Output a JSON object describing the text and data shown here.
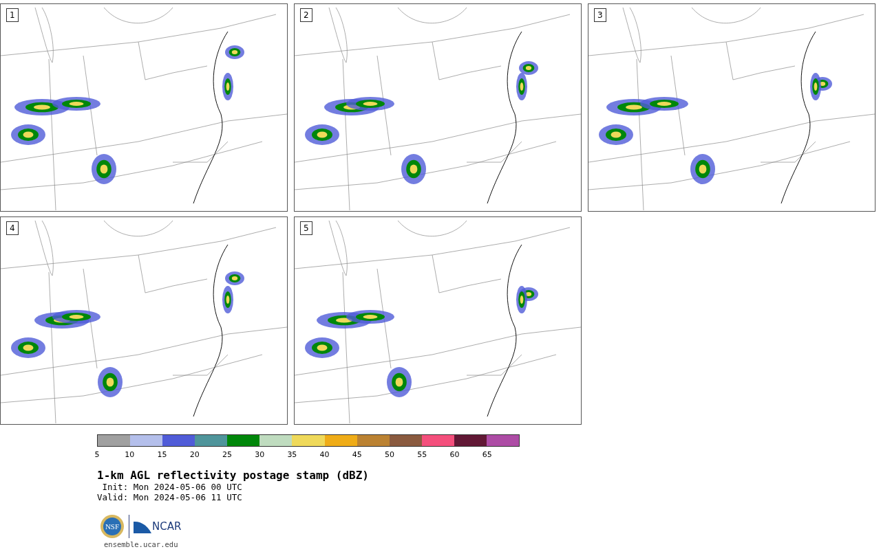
{
  "panels": [
    {
      "label": "1"
    },
    {
      "label": "2"
    },
    {
      "label": "3"
    },
    {
      "label": "4"
    },
    {
      "label": "5"
    }
  ],
  "colorbar": {
    "bins": [
      {
        "color": "#a0a0a0"
      },
      {
        "color": "#b4bfeb"
      },
      {
        "color": "#505cd8"
      },
      {
        "color": "#4f959b"
      },
      {
        "color": "#00870a"
      },
      {
        "color": "#bfdcbf"
      },
      {
        "color": "#efd95a"
      },
      {
        "color": "#efac17"
      },
      {
        "color": "#bb8232"
      },
      {
        "color": "#8a5a3f"
      },
      {
        "color": "#f44f7c"
      },
      {
        "color": "#611835"
      },
      {
        "color": "#ad4ca5"
      }
    ],
    "ticks": [
      "5",
      "10",
      "15",
      "20",
      "25",
      "30",
      "35",
      "40",
      "45",
      "50",
      "55",
      "60",
      "65"
    ]
  },
  "title": "1-km AGL reflectivity postage stamp (dBZ)",
  "init": " Init: Mon 2024-05-06 00 UTC",
  "valid": "Valid: Mon 2024-05-06 11 UTC",
  "logo": {
    "seal": "NSF",
    "wordmark": "NCAR"
  },
  "footer": "ensemble.ucar.edu"
}
